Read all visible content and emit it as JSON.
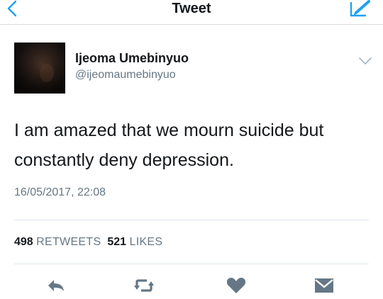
{
  "header": {
    "title": "Tweet"
  },
  "author": {
    "name": "Ijeoma Umebinyuo",
    "handle": "@ijeomaumebinyuo"
  },
  "tweet": {
    "line1": "I am amazed that we mourn suicide but",
    "line2": "constantly deny depression.",
    "timestamp": "16/05/2017, 22:08"
  },
  "stats": {
    "retweets_count": "498",
    "retweets_label": "RETWEETS",
    "likes_count": "521",
    "likes_label": "LIKES"
  },
  "icons": {
    "back": "chevron-left-icon",
    "compose": "compose-icon",
    "more": "chevron-down-icon",
    "reply": "reply-icon",
    "retweet": "retweet-icon",
    "like": "heart-icon",
    "dm": "envelope-icon"
  },
  "colors": {
    "accent": "#1da1f2",
    "icon_gray": "#657786",
    "text": "#14171a"
  }
}
